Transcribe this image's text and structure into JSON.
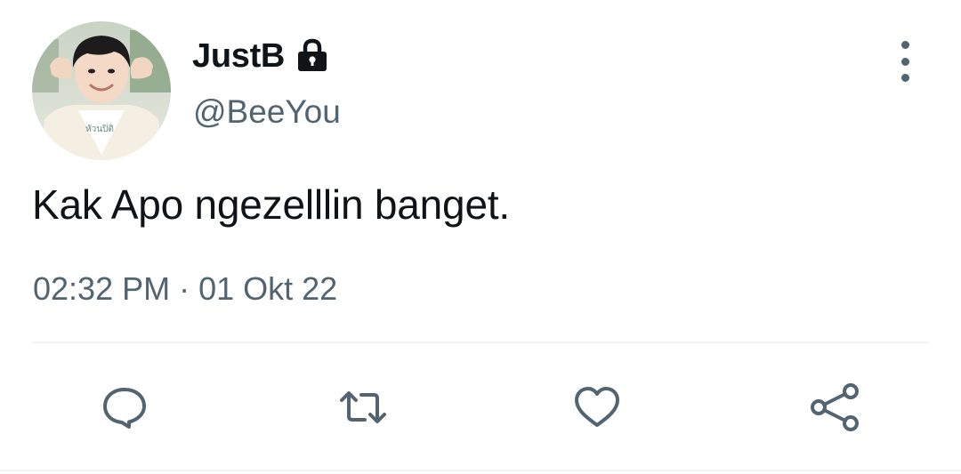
{
  "tweet": {
    "display_name": "JustB",
    "handle": "@BeeYou",
    "text": "Kak Apo ngezelllin banget.",
    "time": "02:32 PM",
    "separator": "·",
    "date": "01 Okt 22",
    "protected_icon": "lock-icon",
    "avatar_shirt_text": "หัวนปิติ"
  },
  "actions": [
    {
      "name": "reply",
      "icon": "comment-icon"
    },
    {
      "name": "retweet",
      "icon": "retweet-icon"
    },
    {
      "name": "like",
      "icon": "heart-icon"
    },
    {
      "name": "share",
      "icon": "share-icon"
    }
  ],
  "colors": {
    "text_primary": "#0f1419",
    "text_secondary": "#536471",
    "divider": "#eff3f4"
  }
}
